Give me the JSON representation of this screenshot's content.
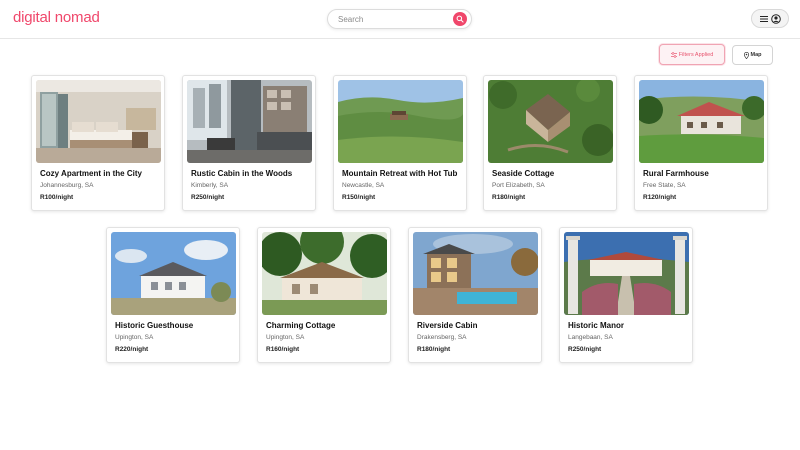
{
  "header": {
    "logo": "digital nomad",
    "search_placeholder": "Search"
  },
  "toolbar": {
    "filters_label": "Filters Applied",
    "map_label": "Map"
  },
  "colors": {
    "brand": "#f0476b"
  },
  "listings": [
    {
      "title": "Cozy Apartment in the City",
      "location": "Johannesburg, SA",
      "price": "R100/night"
    },
    {
      "title": "Rustic Cabin in the Woods",
      "location": "Kimberly, SA",
      "price": "R250/night"
    },
    {
      "title": "Mountain Retreat with Hot Tub",
      "location": "Newcastle, SA",
      "price": "R150/night"
    },
    {
      "title": "Seaside Cottage",
      "location": "Port Elizabeth, SA",
      "price": "R180/night"
    },
    {
      "title": "Rural Farmhouse",
      "location": "Free State, SA",
      "price": "R120/night"
    },
    {
      "title": "Historic Guesthouse",
      "location": "Upington, SA",
      "price": "R220/night"
    },
    {
      "title": "Charming Cottage",
      "location": "Upington, SA",
      "price": "R160/night"
    },
    {
      "title": "Riverside Cabin",
      "location": "Drakensberg, SA",
      "price": "R180/night"
    },
    {
      "title": "Historic Manor",
      "location": "Langebaan, SA",
      "price": "R250/night"
    }
  ]
}
